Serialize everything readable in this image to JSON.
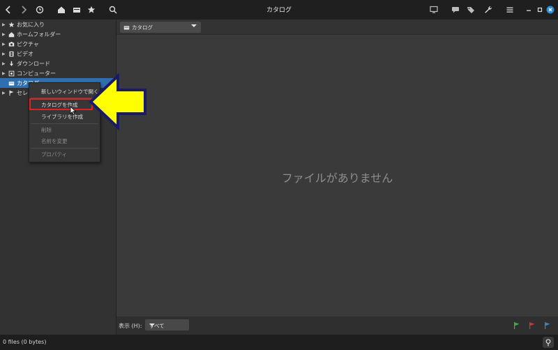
{
  "window": {
    "title": "カタログ"
  },
  "sidebar": {
    "items": [
      {
        "label": "お気に入り",
        "icon": "star-icon"
      },
      {
        "label": "ホームフォルダー",
        "icon": "home-icon"
      },
      {
        "label": "ピクチャ",
        "icon": "camera-icon"
      },
      {
        "label": "ビデオ",
        "icon": "film-icon"
      },
      {
        "label": "ダウンロード",
        "icon": "download-icon"
      },
      {
        "label": "コンピューター",
        "icon": "computer-icon"
      },
      {
        "label": "カタログ",
        "icon": "catalog-icon"
      },
      {
        "label": "セレクション",
        "icon": "flag-icon"
      }
    ]
  },
  "location": {
    "label": "カタログ"
  },
  "main": {
    "empty_message": "ファイルがありません"
  },
  "context_menu": {
    "items": [
      {
        "label": "新しいウィンドウで開く",
        "enabled": true
      },
      {
        "label": "カタログを作成",
        "enabled": true
      },
      {
        "label": "ライブラリを作成",
        "enabled": true
      },
      {
        "label": "削除",
        "enabled": false
      },
      {
        "label": "名前を変更",
        "enabled": false
      },
      {
        "label": "プロパティ",
        "enabled": false
      }
    ]
  },
  "bottom_bar": {
    "show_label": "表示 (H):",
    "show_value": "すべて"
  },
  "status": {
    "text": "0 files (0 bytes)"
  },
  "colors": {
    "selection": "#2f6fb0",
    "highlight_box": "#e02222",
    "arrow_fill": "#ffff00",
    "arrow_stroke": "#1a1a6b",
    "flag_green": "#3cb33c",
    "flag_red": "#d93030",
    "flag_blue": "#3a86c8",
    "close_button": "#2e8fd6"
  },
  "sidebar_selection": "カタログ"
}
